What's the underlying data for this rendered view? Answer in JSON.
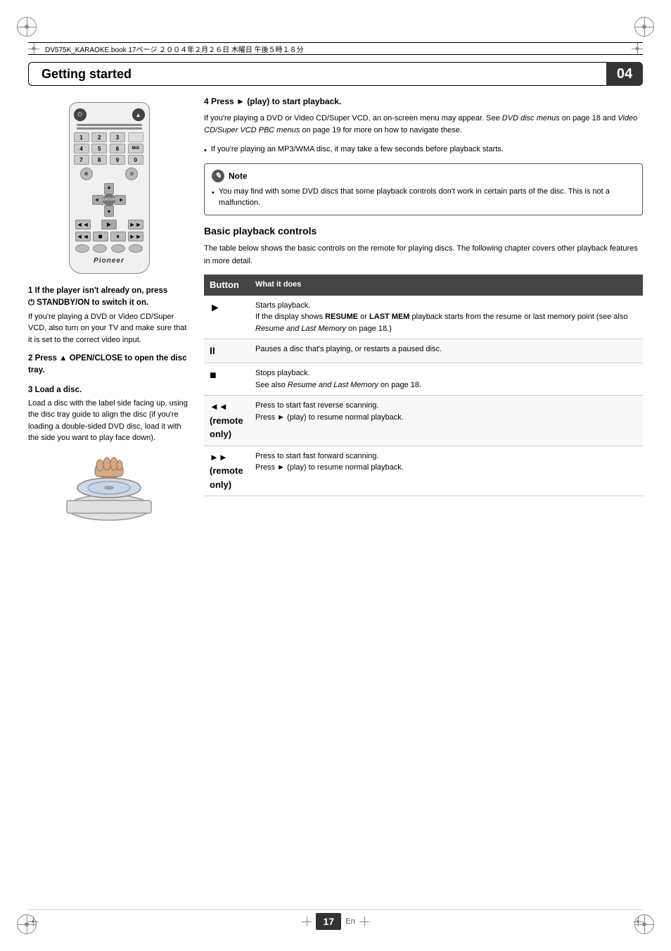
{
  "header": {
    "file_info": "DV575K_KARAOKE.book  17ページ  ２００４年２月２６日  木曜日  午後５時１８分",
    "chapter_title": "Getting started",
    "chapter_number": "04"
  },
  "steps": {
    "step1_heading": "1   If the player isn't already on, press",
    "step1_heading2": "⏻ STANDBY/ON to switch it on.",
    "step1_text": "If you're playing a DVD or Video CD/Super VCD, also turn on your TV and make sure that it is set to the correct video input.",
    "step2_heading": "2   Press ▲ OPEN/CLOSE to open the disc tray.",
    "step3_heading": "3   Load a disc.",
    "step3_text": "Load a disc with the label side facing up, using the disc tray guide to align the disc (if you're loading a double-sided DVD disc, load it with the side you want to play face down).",
    "step4_heading": "4   Press ► (play) to start playback.",
    "step4_text": "If you're playing a DVD or Video CD/Super VCD, an on-screen menu may appear. See DVD disc menus on page 18 and Video CD/Super VCD PBC menus on page 19 for more on how to navigate these.",
    "step4_bullet": "If you're playing an MP3/WMA disc, it may take a few seconds before playback starts."
  },
  "note": {
    "label": "Note",
    "bullet": "You may find with some DVD discs that some playback controls don't work in certain parts of the disc. This is not a malfunction."
  },
  "basic_playback": {
    "heading": "Basic playback controls",
    "intro": "The table below shows the basic controls on the remote for playing discs. The following chapter covers other playback features in more detail.",
    "table_headers": [
      "Button",
      "What it does"
    ],
    "rows": [
      {
        "button": "►",
        "description": "Starts playback.\nIf the display shows RESUME or LAST MEM playback starts from the resume or last memory point (see also Resume and Last Memory on page 18.)"
      },
      {
        "button": "II",
        "description": "Pauses a disc that's playing, or restarts a paused disc."
      },
      {
        "button": "■",
        "description": "Stops playback.\nSee also Resume and Last Memory on page 18."
      },
      {
        "button": "◄◄\n(remote\nonly)",
        "description": "Press to start fast reverse scanning.\nPress ► (play) to resume normal playback."
      },
      {
        "button": "►►\n(remote\nonly)",
        "description": "Press to start fast forward scanning.\nPress ► (play) to resume normal playback."
      }
    ]
  },
  "footer": {
    "page_number": "17",
    "language": "En"
  },
  "remote": {
    "brand": "Pioneer",
    "numpad": [
      "1",
      "2",
      "3",
      "",
      "4",
      "5",
      "6",
      "MIX",
      "7",
      "8",
      "9",
      "0"
    ]
  }
}
